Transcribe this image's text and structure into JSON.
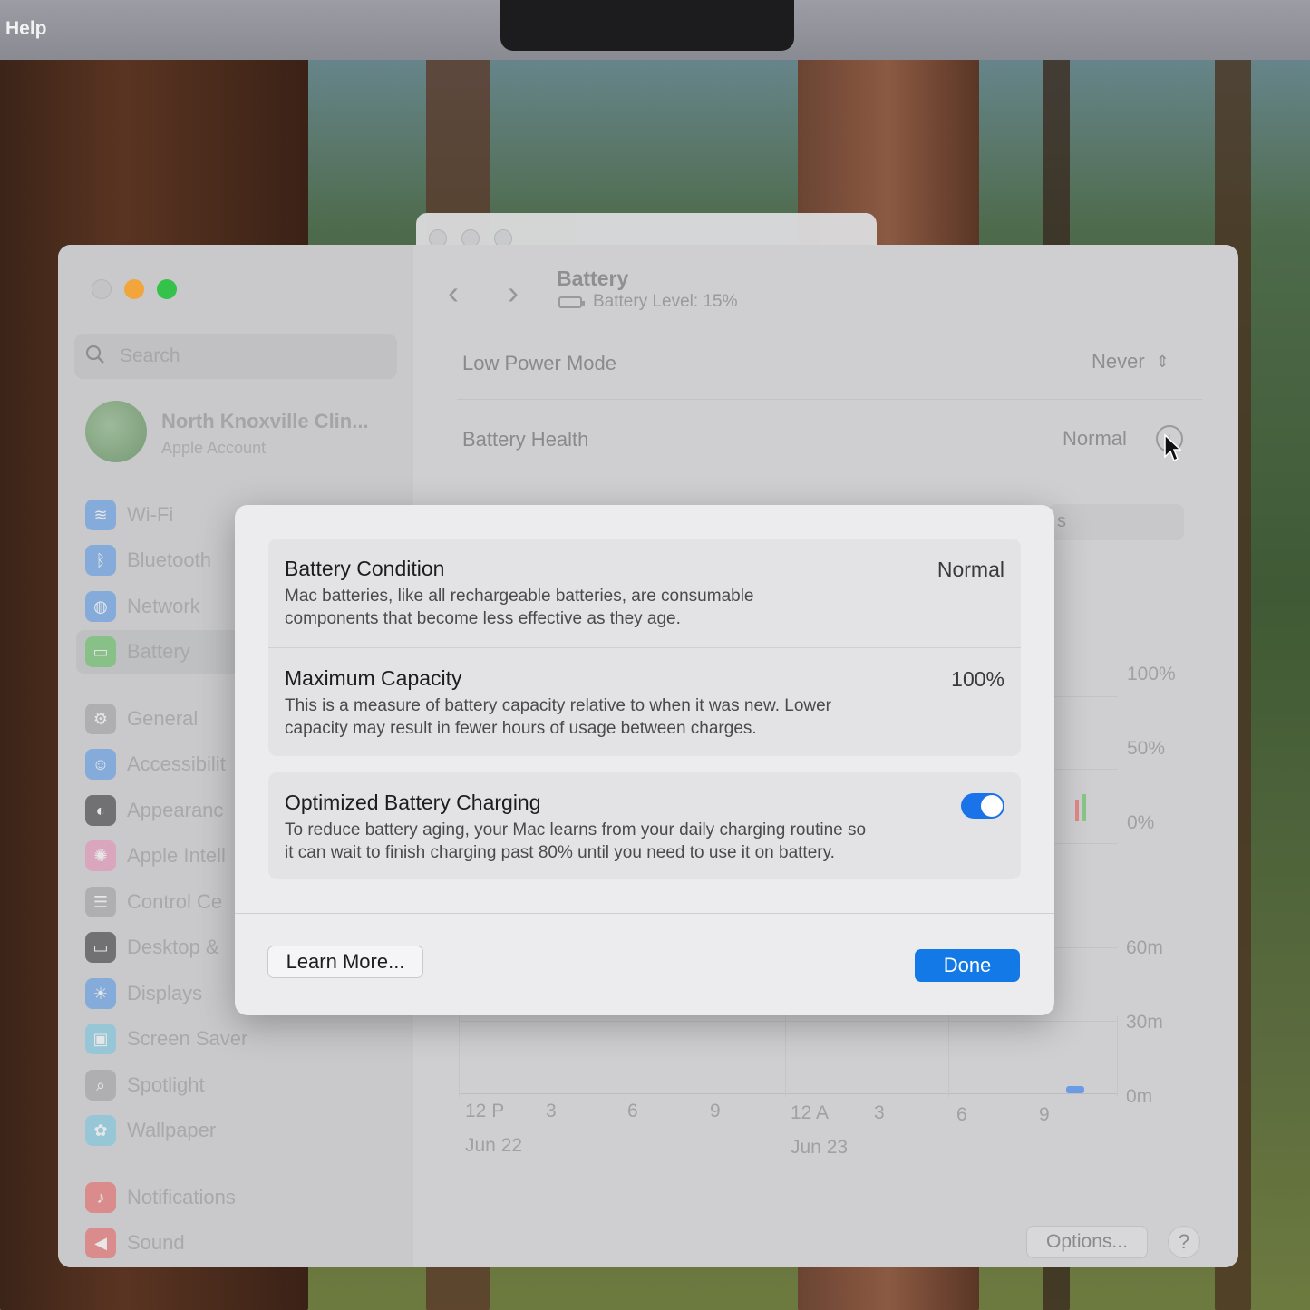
{
  "menubar": {
    "help_label": "Help"
  },
  "sidebar": {
    "search_placeholder": "Search",
    "account": {
      "name": "North Knoxville Clin...",
      "subtitle": "Apple Account"
    },
    "items": [
      {
        "label": "Wi-Fi",
        "icon": "wifi-icon",
        "color": "#4f93e8"
      },
      {
        "label": "Bluetooth",
        "icon": "bluetooth-icon",
        "color": "#4f93e8"
      },
      {
        "label": "Network",
        "icon": "globe-icon",
        "color": "#4f93e8"
      },
      {
        "label": "Battery",
        "icon": "battery-icon",
        "color": "#5cc25a"
      },
      {
        "label": "General",
        "icon": "gear-icon",
        "color": "#9a9a9d"
      },
      {
        "label": "Accessibilit",
        "icon": "accessibility-icon",
        "color": "#4f93e8"
      },
      {
        "label": "Appearanc",
        "icon": "appearance-icon",
        "color": "#2b2b2e"
      },
      {
        "label": "Apple Intell",
        "icon": "apple-intelligence-icon",
        "color": "#e98ab4"
      },
      {
        "label": "Control Ce",
        "icon": "control-center-icon",
        "color": "#9a9a9d"
      },
      {
        "label": "Desktop &",
        "icon": "desktop-icon",
        "color": "#2b2b2e"
      },
      {
        "label": "Displays",
        "icon": "sun-icon",
        "color": "#4f93e8"
      },
      {
        "label": "Screen Saver",
        "icon": "screen-saver-icon",
        "color": "#6fc7e0"
      },
      {
        "label": "Spotlight",
        "icon": "magnifier-icon",
        "color": "#9a9a9d"
      },
      {
        "label": "Wallpaper",
        "icon": "flower-icon",
        "color": "#6fc7e0"
      },
      {
        "label": "Notifications",
        "icon": "bell-icon",
        "color": "#e85a5a"
      },
      {
        "label": "Sound",
        "icon": "speaker-icon",
        "color": "#e85a5a"
      }
    ]
  },
  "content": {
    "title": "Battery",
    "subtitle": "Battery Level: 15%",
    "low_power": {
      "label": "Low Power Mode",
      "value": "Never"
    },
    "health": {
      "label": "Battery Health",
      "value": "Normal"
    },
    "hidden_tab_fragment": "s",
    "chart_level_ticks": [
      "100%",
      "50%",
      "0%"
    ],
    "chart_usage_ticks": [
      "60m",
      "30m",
      "0m"
    ],
    "chart_x_ticks": [
      "12 P",
      "3",
      "6",
      "9",
      "12 A",
      "3",
      "6",
      "9"
    ],
    "chart_dates": [
      "Jun 22",
      "Jun 23"
    ],
    "options_label": "Options...",
    "help_label": "?"
  },
  "sheet": {
    "condition": {
      "title": "Battery Condition",
      "value": "Normal",
      "desc1": "Mac batteries, like all rechargeable batteries, are consumable",
      "desc2": "components that become less effective as they age."
    },
    "capacity": {
      "title": "Maximum Capacity",
      "value": "100%",
      "desc1": "This is a measure of battery capacity relative to when it was new. Lower",
      "desc2": "capacity may result in fewer hours of usage between charges."
    },
    "optimized": {
      "title": "Optimized Battery Charging",
      "enabled": true,
      "desc1": "To reduce battery aging, your Mac learns from your daily charging routine so",
      "desc2": "it can wait to finish charging past 80% until you need to use it on battery."
    },
    "learn_more_label": "Learn More...",
    "done_label": "Done",
    "accent": "#1279e6"
  }
}
